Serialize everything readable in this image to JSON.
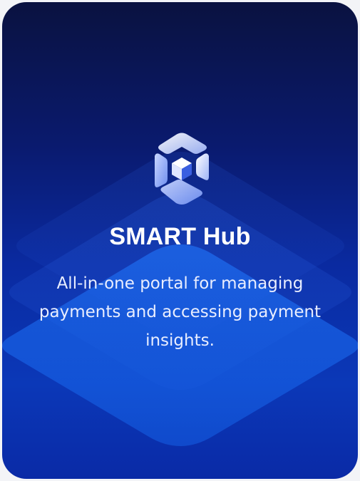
{
  "app": {
    "name": "SMART Hub",
    "tagline": "All-in-one portal for managing payments and accessing payment insights."
  },
  "icons": {
    "logo": "hexagon-cube-logo-icon"
  },
  "colors": {
    "card_top": "#0a1240",
    "card_bottom": "#0b38b8",
    "accent": "#1c6ff0",
    "text": "#ffffff"
  }
}
